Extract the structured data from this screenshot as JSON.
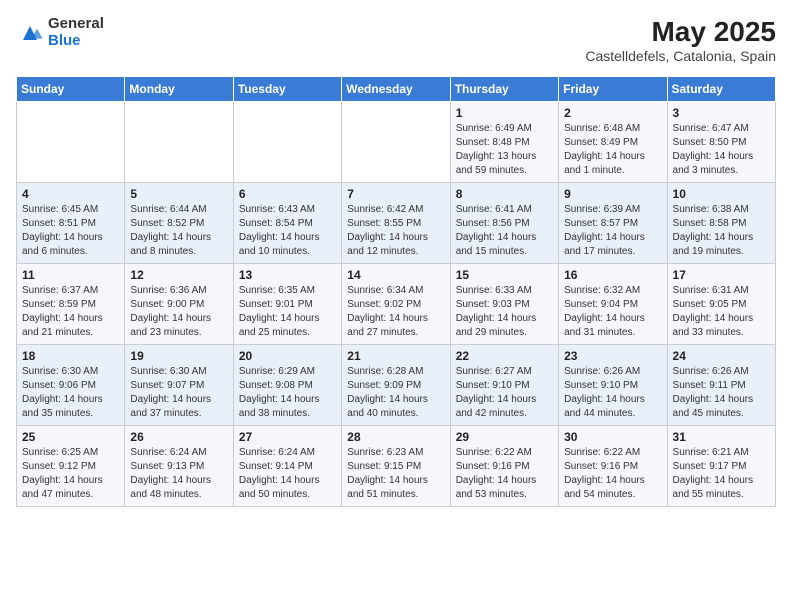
{
  "header": {
    "logo_general": "General",
    "logo_blue": "Blue",
    "month_year": "May 2025",
    "location": "Castelldefels, Catalonia, Spain"
  },
  "days_of_week": [
    "Sunday",
    "Monday",
    "Tuesday",
    "Wednesday",
    "Thursday",
    "Friday",
    "Saturday"
  ],
  "weeks": [
    [
      {
        "num": "",
        "info": ""
      },
      {
        "num": "",
        "info": ""
      },
      {
        "num": "",
        "info": ""
      },
      {
        "num": "",
        "info": ""
      },
      {
        "num": "1",
        "info": "Sunrise: 6:49 AM\nSunset: 8:48 PM\nDaylight: 13 hours and 59 minutes."
      },
      {
        "num": "2",
        "info": "Sunrise: 6:48 AM\nSunset: 8:49 PM\nDaylight: 14 hours and 1 minute."
      },
      {
        "num": "3",
        "info": "Sunrise: 6:47 AM\nSunset: 8:50 PM\nDaylight: 14 hours and 3 minutes."
      }
    ],
    [
      {
        "num": "4",
        "info": "Sunrise: 6:45 AM\nSunset: 8:51 PM\nDaylight: 14 hours and 6 minutes."
      },
      {
        "num": "5",
        "info": "Sunrise: 6:44 AM\nSunset: 8:52 PM\nDaylight: 14 hours and 8 minutes."
      },
      {
        "num": "6",
        "info": "Sunrise: 6:43 AM\nSunset: 8:54 PM\nDaylight: 14 hours and 10 minutes."
      },
      {
        "num": "7",
        "info": "Sunrise: 6:42 AM\nSunset: 8:55 PM\nDaylight: 14 hours and 12 minutes."
      },
      {
        "num": "8",
        "info": "Sunrise: 6:41 AM\nSunset: 8:56 PM\nDaylight: 14 hours and 15 minutes."
      },
      {
        "num": "9",
        "info": "Sunrise: 6:39 AM\nSunset: 8:57 PM\nDaylight: 14 hours and 17 minutes."
      },
      {
        "num": "10",
        "info": "Sunrise: 6:38 AM\nSunset: 8:58 PM\nDaylight: 14 hours and 19 minutes."
      }
    ],
    [
      {
        "num": "11",
        "info": "Sunrise: 6:37 AM\nSunset: 8:59 PM\nDaylight: 14 hours and 21 minutes."
      },
      {
        "num": "12",
        "info": "Sunrise: 6:36 AM\nSunset: 9:00 PM\nDaylight: 14 hours and 23 minutes."
      },
      {
        "num": "13",
        "info": "Sunrise: 6:35 AM\nSunset: 9:01 PM\nDaylight: 14 hours and 25 minutes."
      },
      {
        "num": "14",
        "info": "Sunrise: 6:34 AM\nSunset: 9:02 PM\nDaylight: 14 hours and 27 minutes."
      },
      {
        "num": "15",
        "info": "Sunrise: 6:33 AM\nSunset: 9:03 PM\nDaylight: 14 hours and 29 minutes."
      },
      {
        "num": "16",
        "info": "Sunrise: 6:32 AM\nSunset: 9:04 PM\nDaylight: 14 hours and 31 minutes."
      },
      {
        "num": "17",
        "info": "Sunrise: 6:31 AM\nSunset: 9:05 PM\nDaylight: 14 hours and 33 minutes."
      }
    ],
    [
      {
        "num": "18",
        "info": "Sunrise: 6:30 AM\nSunset: 9:06 PM\nDaylight: 14 hours and 35 minutes."
      },
      {
        "num": "19",
        "info": "Sunrise: 6:30 AM\nSunset: 9:07 PM\nDaylight: 14 hours and 37 minutes."
      },
      {
        "num": "20",
        "info": "Sunrise: 6:29 AM\nSunset: 9:08 PM\nDaylight: 14 hours and 38 minutes."
      },
      {
        "num": "21",
        "info": "Sunrise: 6:28 AM\nSunset: 9:09 PM\nDaylight: 14 hours and 40 minutes."
      },
      {
        "num": "22",
        "info": "Sunrise: 6:27 AM\nSunset: 9:10 PM\nDaylight: 14 hours and 42 minutes."
      },
      {
        "num": "23",
        "info": "Sunrise: 6:26 AM\nSunset: 9:10 PM\nDaylight: 14 hours and 44 minutes."
      },
      {
        "num": "24",
        "info": "Sunrise: 6:26 AM\nSunset: 9:11 PM\nDaylight: 14 hours and 45 minutes."
      }
    ],
    [
      {
        "num": "25",
        "info": "Sunrise: 6:25 AM\nSunset: 9:12 PM\nDaylight: 14 hours and 47 minutes."
      },
      {
        "num": "26",
        "info": "Sunrise: 6:24 AM\nSunset: 9:13 PM\nDaylight: 14 hours and 48 minutes."
      },
      {
        "num": "27",
        "info": "Sunrise: 6:24 AM\nSunset: 9:14 PM\nDaylight: 14 hours and 50 minutes."
      },
      {
        "num": "28",
        "info": "Sunrise: 6:23 AM\nSunset: 9:15 PM\nDaylight: 14 hours and 51 minutes."
      },
      {
        "num": "29",
        "info": "Sunrise: 6:22 AM\nSunset: 9:16 PM\nDaylight: 14 hours and 53 minutes."
      },
      {
        "num": "30",
        "info": "Sunrise: 6:22 AM\nSunset: 9:16 PM\nDaylight: 14 hours and 54 minutes."
      },
      {
        "num": "31",
        "info": "Sunrise: 6:21 AM\nSunset: 9:17 PM\nDaylight: 14 hours and 55 minutes."
      }
    ]
  ]
}
